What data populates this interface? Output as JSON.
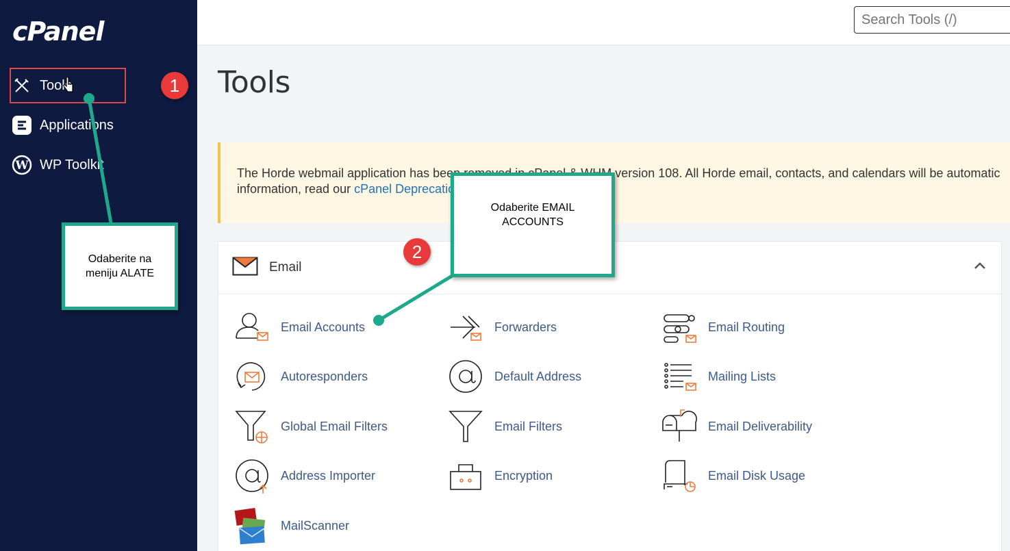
{
  "sidebar": {
    "logo": "cPanel",
    "items": [
      {
        "label": "Tools",
        "icon": "tools-icon"
      },
      {
        "label": "Applications",
        "icon": "applications-icon"
      },
      {
        "label": "WP Toolkit",
        "icon": "wordpress-icon"
      }
    ]
  },
  "header": {
    "search_placeholder": "Search Tools (/)"
  },
  "main": {
    "title": "Tools",
    "notice": {
      "text_before": "The Horde webmail application has been removed in cPanel & WHM version 108. All Horde email, contacts, and calendars will be automatic",
      "text_line2": "information, read our ",
      "link": "cPanel Deprecation"
    },
    "email_panel": {
      "title": "Email",
      "tools": [
        {
          "label": "Email Accounts",
          "icon": "email-accounts-icon"
        },
        {
          "label": "Forwarders",
          "icon": "forwarders-icon"
        },
        {
          "label": "Email Routing",
          "icon": "email-routing-icon"
        },
        {
          "label": "Autoresponders",
          "icon": "autoresponders-icon"
        },
        {
          "label": "Default Address",
          "icon": "default-address-icon"
        },
        {
          "label": "Mailing Lists",
          "icon": "mailing-lists-icon"
        },
        {
          "label": "Global Email Filters",
          "icon": "global-email-filters-icon"
        },
        {
          "label": "Email Filters",
          "icon": "email-filters-icon"
        },
        {
          "label": "Email Deliverability",
          "icon": "email-deliverability-icon"
        },
        {
          "label": "Address Importer",
          "icon": "address-importer-icon"
        },
        {
          "label": "Encryption",
          "icon": "encryption-icon"
        },
        {
          "label": "Email Disk Usage",
          "icon": "email-disk-usage-icon"
        },
        {
          "label": "MailScanner",
          "icon": "mailscanner-icon"
        }
      ]
    }
  },
  "annotations": {
    "callout1": "Odaberite na meniju ALATE",
    "callout2": "Odaberite EMAIL ACCOUNTS",
    "badge1": "1",
    "badge2": "2"
  },
  "colors": {
    "sidebar_bg": "#0e1a3f",
    "link_blue": "#3e5a89",
    "accent_orange": "#f07a3c",
    "callout_green": "#1fa889",
    "badge_red": "#e83a3a",
    "highlight_red": "#e04848"
  }
}
